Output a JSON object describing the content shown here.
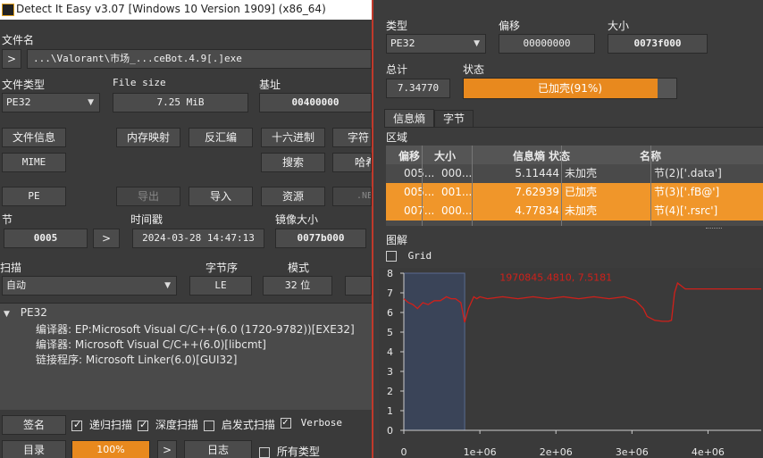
{
  "window": {
    "title": "Detect It Easy v3.07 [Windows 10 Version 1909] (x86_64)"
  },
  "file": {
    "label": "文件名",
    "path": "...\\Valorant\\市场_...ceBot.4.9[.]exe",
    "browse": ">"
  },
  "filetype": {
    "label": "文件类型",
    "value": "PE32"
  },
  "filesize": {
    "label": "File size",
    "value": "7.25 MiB"
  },
  "base": {
    "label": "基址",
    "value": "00400000"
  },
  "buttons1": {
    "fileinfo": "文件信息",
    "memmap": "内存映射",
    "disasm": "反汇编",
    "hex": "十六进制",
    "strings": "字符"
  },
  "buttons2": {
    "mime": "MIME",
    "search": "搜索",
    "hash": "哈希"
  },
  "buttons3": {
    "pe": "PE",
    "export": "导出",
    "import": "导入",
    "resource": "资源",
    "net": ".NET"
  },
  "section": {
    "label": "节",
    "value": "0005",
    "next": ">"
  },
  "timestamp": {
    "label": "时间戳",
    "value": "2024-03-28 14:47:13"
  },
  "imagesize": {
    "label": "镜像大小",
    "value": "0077b000"
  },
  "scan": {
    "label": "扫描",
    "value": "自动"
  },
  "endian": {
    "label": "字节序",
    "value": "LE"
  },
  "mode": {
    "label": "模式",
    "value": "32 位"
  },
  "results": {
    "root": "PE32",
    "lines": [
      "编译器: EP:Microsoft Visual C/C++(6.0 (1720-9782))[EXE32]",
      "编译器: Microsoft Visual C/C++(6.0)[libcmt]",
      "链接程序: Microsoft Linker(6.0)[GUI32]"
    ]
  },
  "bottom": {
    "signature": "签名",
    "recursive": "递归扫描",
    "deep": "深度扫描",
    "heuristic": "启发式扫描",
    "verbose": "Verbose",
    "dir": "目录",
    "progress": "100%",
    "next": ">",
    "log": "日志",
    "alltypes": "所有类型"
  },
  "entropy": {
    "type_label": "类型",
    "type_value": "PE32",
    "offset_label": "偏移",
    "offset_value": "00000000",
    "size_label": "大小",
    "size_value": "0073f000",
    "total_label": "总计",
    "total_value": "7.34770",
    "status_label": "状态",
    "status_value": "已加壳(91%)",
    "status_fill": 0.91,
    "tabs": [
      "信息熵",
      "字节"
    ],
    "region_label": "区域",
    "columns": [
      "偏移",
      "大小",
      "信息熵",
      "状态",
      "名称"
    ],
    "rows": [
      {
        "offset": "005...",
        "size": "000...",
        "entropy": "5.11444",
        "status": "未加壳",
        "name": "节(2)['.data']",
        "highlight": false
      },
      {
        "offset": "005...",
        "size": "001...",
        "entropy": "7.62939",
        "status": "已加壳",
        "name": "节(3)['.fB@']",
        "highlight": true
      },
      {
        "offset": "007...",
        "size": "000...",
        "entropy": "4.77834",
        "status": "未加壳",
        "name": "节(4)['.rsrc']",
        "highlight": true
      }
    ],
    "chart_label": "图解",
    "grid_label": "Grid",
    "annotation": "1970845.4810, 7.5181"
  },
  "chart_data": {
    "type": "line",
    "title": "",
    "xlabel": "",
    "ylabel": "",
    "xlim": [
      0,
      4700000
    ],
    "ylim": [
      0,
      8
    ],
    "xticks": [
      "0",
      "1e+06",
      "2e+06",
      "3e+06",
      "4e+06"
    ],
    "yticks": [
      "0",
      "1",
      "2",
      "3",
      "4",
      "5",
      "6",
      "7",
      "8"
    ],
    "grid": false,
    "selection_range": [
      0,
      800000
    ],
    "series": [
      {
        "color": "#d0201a",
        "x": [
          0,
          60000,
          120000,
          180000,
          250000,
          320000,
          400000,
          480000,
          560000,
          620000,
          680000,
          750000,
          800000,
          850000,
          920000,
          960000,
          1000000,
          1100000,
          1300000,
          1500000,
          1700000,
          1900000,
          2100000,
          2300000,
          2500000,
          2700000,
          2900000,
          3050000,
          3150000,
          3200000,
          3300000,
          3400000,
          3480000,
          3520000,
          3560000,
          3600000,
          3700000,
          3800000,
          4000000,
          4200000,
          4400000,
          4700000
        ],
        "y": [
          6.7,
          6.5,
          6.4,
          6.2,
          6.5,
          6.4,
          6.6,
          6.6,
          6.8,
          6.7,
          6.7,
          6.5,
          5.5,
          6.2,
          6.8,
          6.7,
          6.8,
          6.7,
          6.8,
          6.7,
          6.8,
          6.7,
          6.8,
          6.7,
          6.8,
          6.7,
          6.8,
          6.6,
          6.2,
          5.8,
          5.6,
          5.55,
          5.55,
          5.6,
          7.0,
          7.5,
          7.2,
          7.2,
          7.2,
          7.2,
          7.2,
          7.2
        ]
      }
    ]
  }
}
